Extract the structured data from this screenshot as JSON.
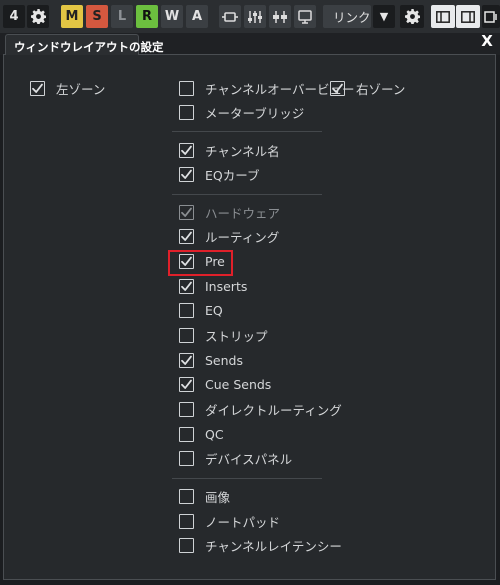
{
  "toolbar": {
    "num_label": "4",
    "m_label": "M",
    "s_label": "S",
    "l_label": "L",
    "r_label": "R",
    "w_label": "W",
    "a_label": "A",
    "link_label": "リンク"
  },
  "dialog": {
    "tab_title": "ウィンドウレイアウトの設定",
    "close_label": "X"
  },
  "options": {
    "left_zone": {
      "label": "左ゾーン",
      "checked": true
    },
    "right_zone": {
      "label": "右ゾーン",
      "checked": true
    },
    "channel_overview": {
      "label": "チャンネルオーバービュー",
      "checked": false
    },
    "meter_bridge": {
      "label": "メーターブリッジ",
      "checked": false
    },
    "channel_name": {
      "label": "チャンネル名",
      "checked": true
    },
    "eq_curve": {
      "label": "EQカーブ",
      "checked": true
    },
    "hardware": {
      "label": "ハードウェア",
      "checked": true,
      "disabled": true
    },
    "routing": {
      "label": "ルーティング",
      "checked": true
    },
    "pre": {
      "label": "Pre",
      "checked": true
    },
    "inserts": {
      "label": "Inserts",
      "checked": true
    },
    "eq": {
      "label": "EQ",
      "checked": false
    },
    "strip": {
      "label": "ストリップ",
      "checked": false
    },
    "sends": {
      "label": "Sends",
      "checked": true
    },
    "cue_sends": {
      "label": "Cue Sends",
      "checked": true
    },
    "direct_routing": {
      "label": "ダイレクトルーティング",
      "checked": false
    },
    "qc": {
      "label": "QC",
      "checked": false
    },
    "device_panel": {
      "label": "デバイスパネル",
      "checked": false
    },
    "image": {
      "label": "画像",
      "checked": false
    },
    "notepad": {
      "label": "ノートパッド",
      "checked": false
    },
    "channel_latency": {
      "label": "チャンネルレイテンシー",
      "checked": false
    }
  },
  "colors": {
    "highlight_box": "#e0202a",
    "mute_yellow": "#e2c544",
    "solo_red": "#d4583f",
    "read_green": "#6cbf3f"
  }
}
